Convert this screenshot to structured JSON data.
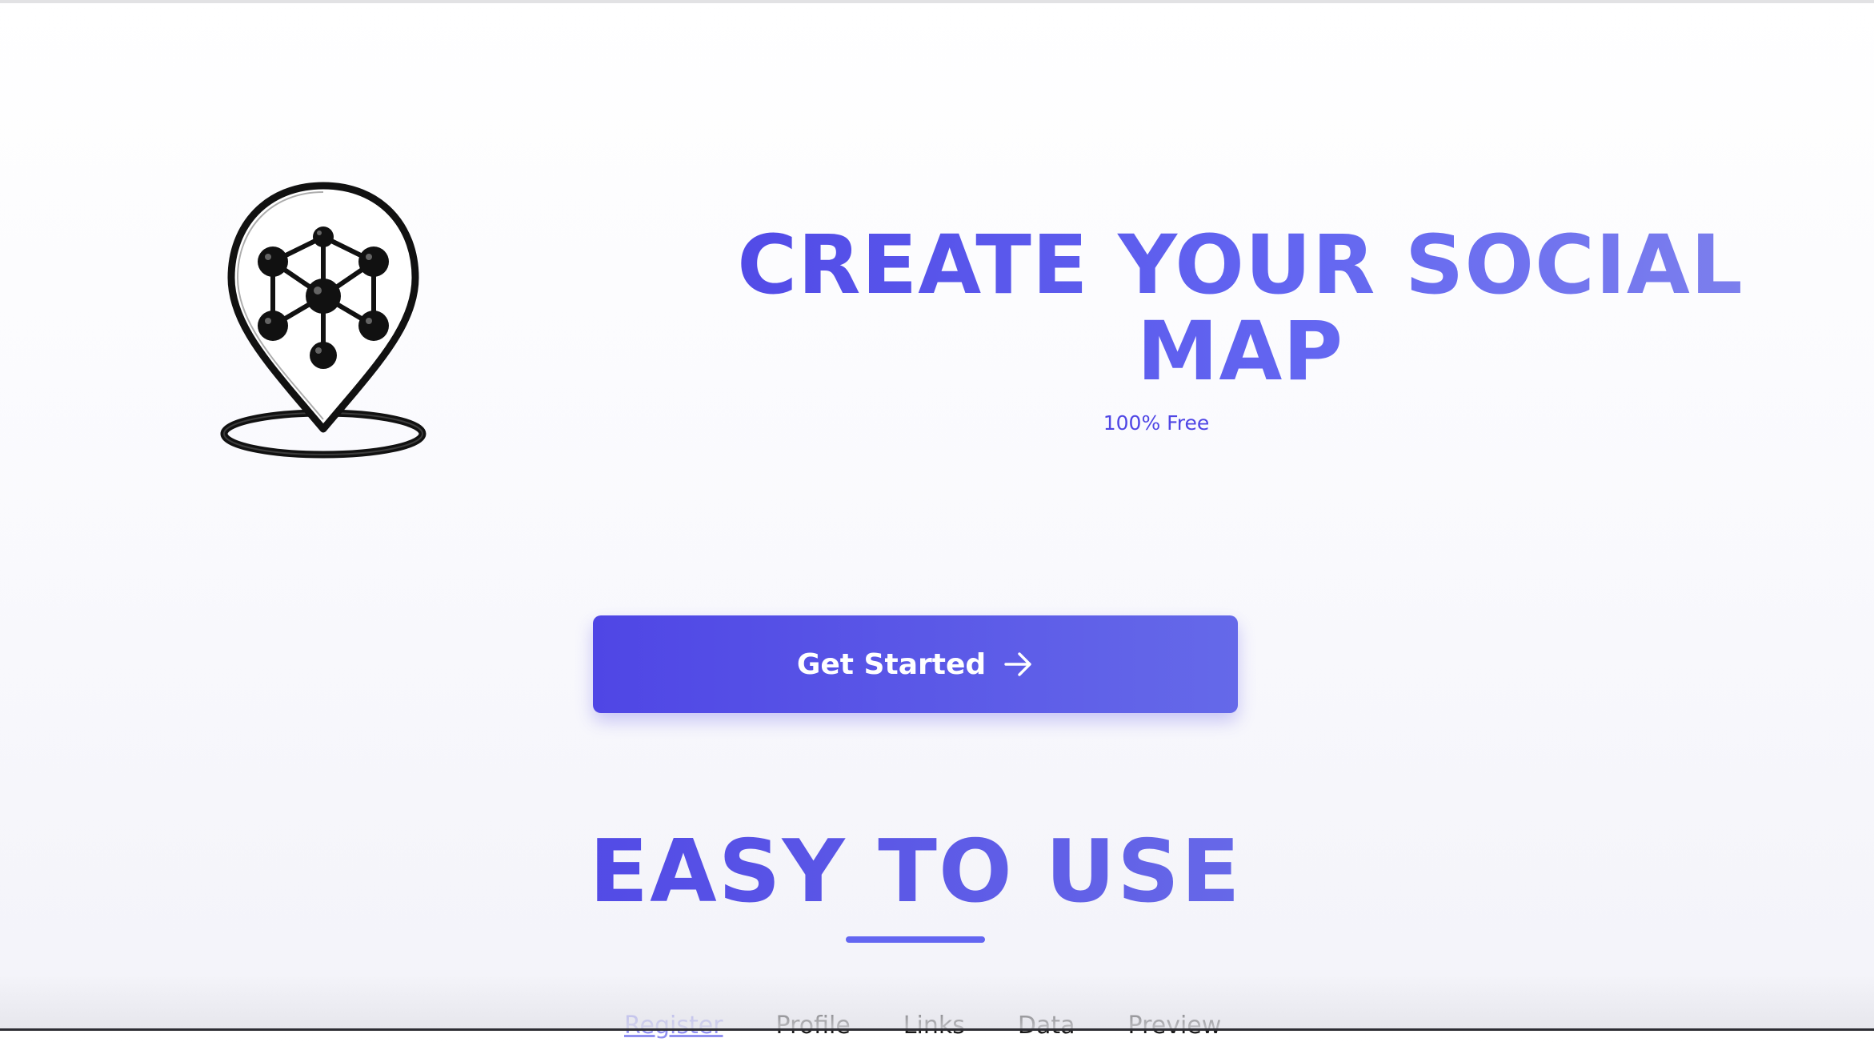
{
  "hero": {
    "title_line1": "CREATE YOUR SOCIAL",
    "title_line2": "MAP",
    "subtitle": "100% Free",
    "logo_icon": "map-pin-network-icon"
  },
  "cta": {
    "label": "Get Started",
    "icon": "arrow-right-icon"
  },
  "section": {
    "title": "EASY TO USE"
  },
  "steps": {
    "active": "Register",
    "tabs": [
      "Register",
      "Profile",
      "Links",
      "Data",
      "Preview"
    ]
  },
  "colors": {
    "primary": "#4f46e5",
    "primary_light": "#6366f1",
    "tab_active": "#8f8ff0",
    "text_dark": "#1a1a1a"
  }
}
